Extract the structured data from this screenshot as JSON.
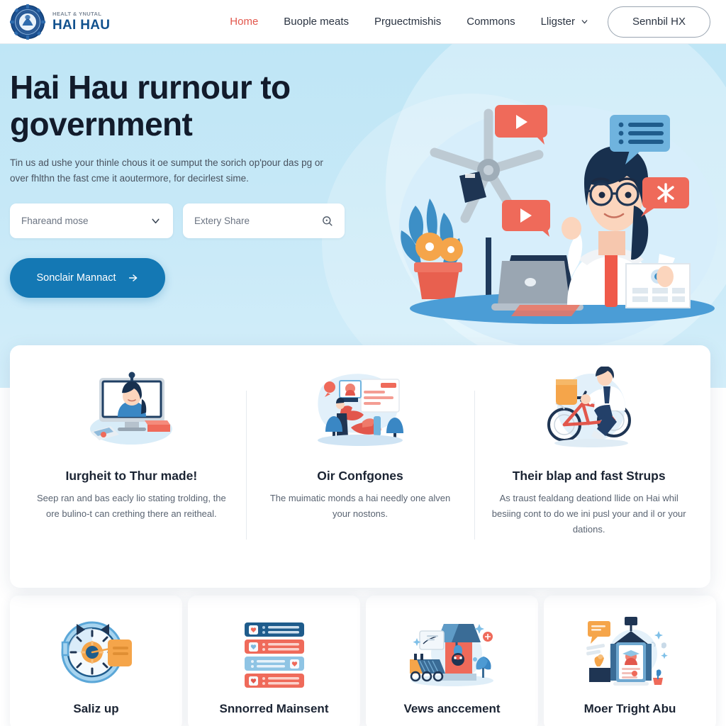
{
  "nav": {
    "brand": {
      "tagline": "HEALT & YNUTAL",
      "name": "HAI HAU",
      "seal_icon": "government-seal-icon"
    },
    "links": [
      {
        "label": "Home",
        "active": true
      },
      {
        "label": "Buople meats",
        "active": false
      },
      {
        "label": "Prguectmishis",
        "active": false
      },
      {
        "label": "Commons",
        "active": false
      },
      {
        "label": "Lligster",
        "active": false,
        "has_chevron": true
      }
    ],
    "cta_label": "Sennbil HX"
  },
  "hero": {
    "title": "Hai Hau rurnour to government",
    "subtitle": "Tin us ad ushe your thinle chous it oe sumput the sorich op'pour das pg or over fhlthn the fast cme it aoutermore, for decirlest sime.",
    "select": {
      "value": "Fhareand mose",
      "chevron_icon": "chevron-down-icon"
    },
    "search": {
      "value": "Extery Share",
      "placeholder": "Extery Share",
      "icon": "search-icon"
    },
    "button": {
      "label": "Sonclair Mannact",
      "icon": "arrow-right-icon"
    },
    "illustration": "woman-at-laptop-with-speech-bubbles-illustration",
    "bg_color": "#c6e8f7",
    "button_color": "#1478b4"
  },
  "features": [
    {
      "title": "Iurgheit to Thur made!",
      "desc": "Seep ran and bas eacly lio stating trolding, the ore bulino-t can crething there an reitheal.",
      "art": "video-call-on-monitor-illustration"
    },
    {
      "title": "Oir Confgones",
      "desc": "The muimatic monds a hai needly one alven your nostons.",
      "art": "person-presenting-documents-illustration"
    },
    {
      "title": "Their blap and fast Strups",
      "desc": "As traust fealdang deationd llide on Hai whil besiing cont to do we ini pusl your and il or your dations.",
      "art": "delivery-cyclist-illustration"
    }
  ],
  "bottom_cards": [
    {
      "label": "Saliz up",
      "art": "stopwatch-timer-illustration"
    },
    {
      "label": "Snnorred Mainsent",
      "art": "stacked-list-cards-illustration"
    },
    {
      "label": "Vews anccement",
      "art": "industry-factory-illustration"
    },
    {
      "label": "Moer Tright Abu",
      "art": "monitor-profile-illustration"
    }
  ],
  "colors": {
    "accent_red": "#e2574c",
    "brand_blue": "#11518e",
    "primary_blue": "#1478b4"
  }
}
